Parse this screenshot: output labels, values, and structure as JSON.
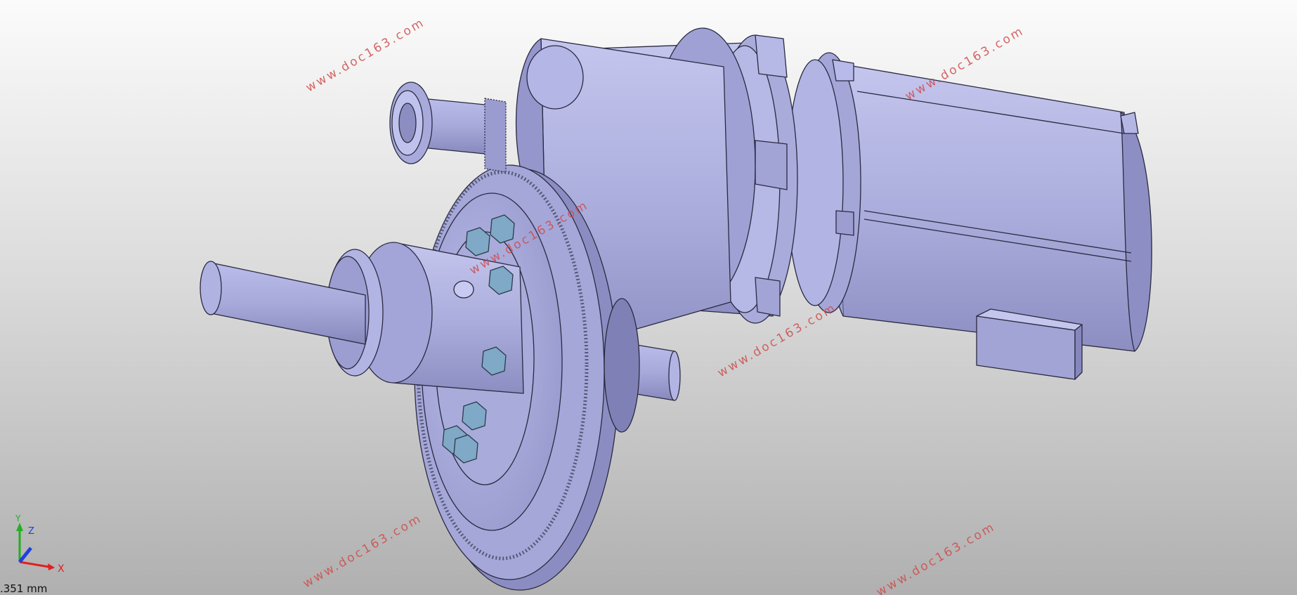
{
  "viewport": {
    "watermark_text": "www.doc163.com",
    "scale_readout": ".351 mm"
  },
  "axis_triad": {
    "x_label": "X",
    "y_label": "Y",
    "z_label": "Z",
    "colors": {
      "x": "#e02020",
      "y": "#20b020",
      "z": "#2040e0"
    }
  },
  "model": {
    "body_color": "#a9abdb",
    "shade_color": "#8a8cc0",
    "highlight_color": "#c6c8ef",
    "edge_color": "#2a2a40",
    "bolt_color": "#7fa9c6"
  }
}
